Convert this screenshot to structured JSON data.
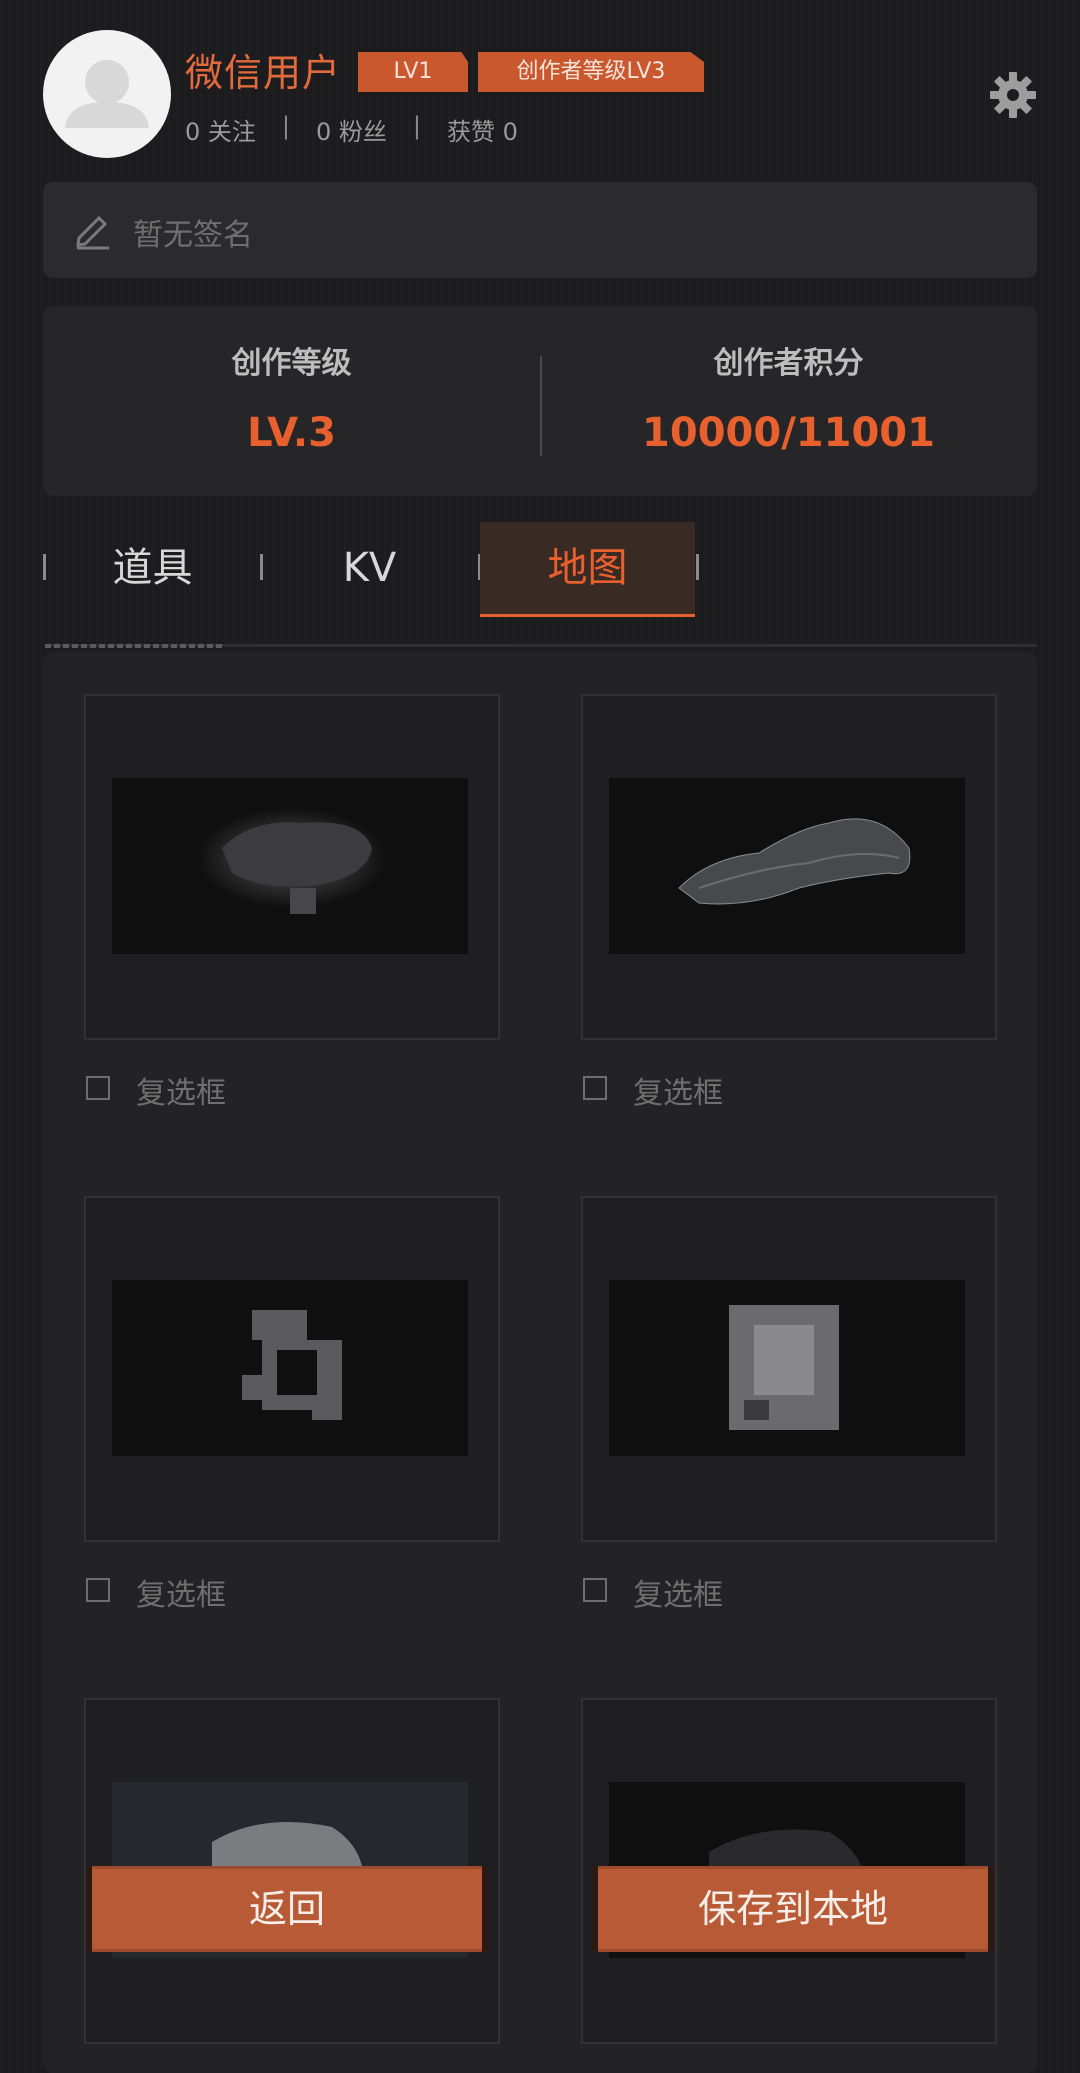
{
  "profile": {
    "username": "微信用户",
    "badge_level": "LV1",
    "badge_creator": "创作者等级LV3",
    "follow": "0 关注",
    "fans": "0 粉丝",
    "likes": "获赞 0",
    "separator": "|"
  },
  "signature": {
    "text": "暂无签名"
  },
  "levels": {
    "creator_level_title": "创作等级",
    "creator_level_value": "LV.3",
    "points_title": "创作者积分",
    "points_value": "10000/11001"
  },
  "tabs": [
    {
      "label": "道具",
      "active": false
    },
    {
      "label": "KV",
      "active": false
    },
    {
      "label": "地图",
      "active": true
    }
  ],
  "maps": [
    {
      "checkbox_label": "复选框",
      "checked": false
    },
    {
      "checkbox_label": "复选框",
      "checked": false
    },
    {
      "checkbox_label": "复选框",
      "checked": false
    },
    {
      "checkbox_label": "复选框",
      "checked": false
    },
    {
      "checkbox_label": "",
      "checked": false
    },
    {
      "checkbox_label": "",
      "checked": false
    }
  ],
  "buttons": {
    "back": "返回",
    "save": "保存到本地"
  },
  "colors": {
    "accent": "#e8602d",
    "background": "#1c1c1e",
    "button": "#b85a35"
  }
}
